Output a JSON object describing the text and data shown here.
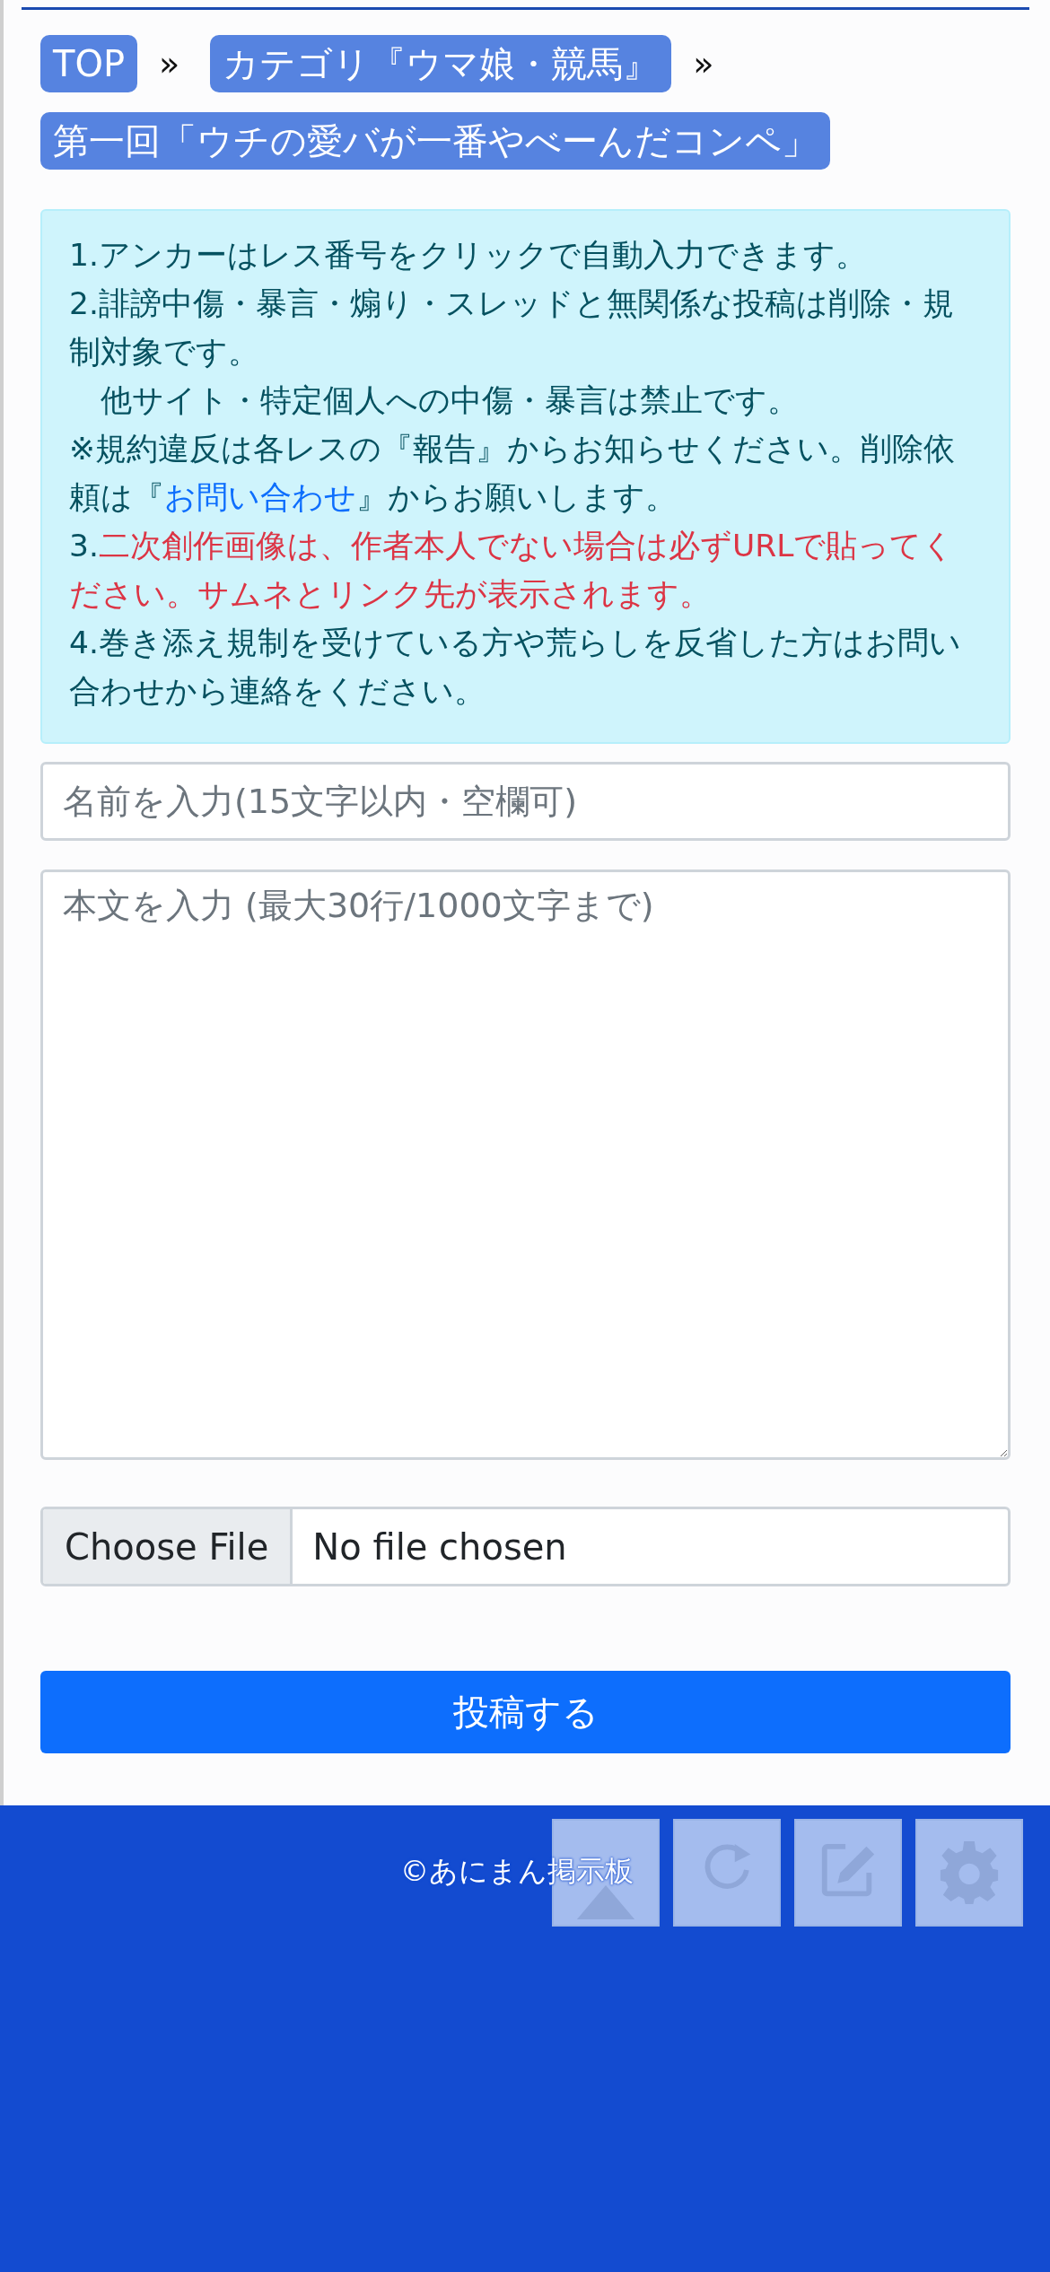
{
  "breadcrumb": [
    {
      "label": "TOP",
      "separator": "»"
    },
    {
      "label": "カテゴリ『ウマ娘・競馬』",
      "separator": "»"
    },
    {
      "label": "第一回「ウチの愛バが一番やべーんだコンペ」"
    }
  ],
  "notice": [
    [
      {
        "kind": "text",
        "text": "1.アンカーはレス番号をクリックで自動入力できます。"
      }
    ],
    [
      {
        "kind": "text",
        "text": "2.誹謗中傷・暴言・煽り・スレッドと無関係な投稿は削除・規制対象です。"
      }
    ],
    [
      {
        "kind": "text",
        "text": "　他サイト・特定個人への中傷・暴言は禁止です。"
      }
    ],
    [
      {
        "kind": "text",
        "text": "※規約違反は各レスの『報告』からお知らせください。削除依頼は『"
      },
      {
        "kind": "link",
        "text": "お問い合わせ"
      },
      {
        "kind": "text",
        "text": "』からお願いします。"
      }
    ],
    [
      {
        "kind": "text",
        "text": "3."
      },
      {
        "kind": "warning",
        "text": "二次創作画像は、作者本人でない場合は必ずURLで貼ってください。サムネとリンク先が表示されます。"
      }
    ],
    [
      {
        "kind": "text",
        "text": "4.巻き添え規制を受けている方や荒らしを反省した方はお問い合わせから連絡をください。"
      }
    ]
  ],
  "name_field": {
    "placeholder": "名前を入力(15文字以内・空欄可)"
  },
  "body_field": {
    "placeholder": "本文を入力 (最大30行/1000文字まで)"
  },
  "file_input": {
    "button": "Choose File",
    "status": "No file chosen"
  },
  "submit_button": "投稿する",
  "footer": {
    "copyright": "©あにまん掲示板"
  },
  "floating_buttons": [
    {
      "kind": "triangle"
    },
    {
      "kind": "reload"
    },
    {
      "kind": "edit"
    },
    {
      "kind": "settings"
    }
  ]
}
